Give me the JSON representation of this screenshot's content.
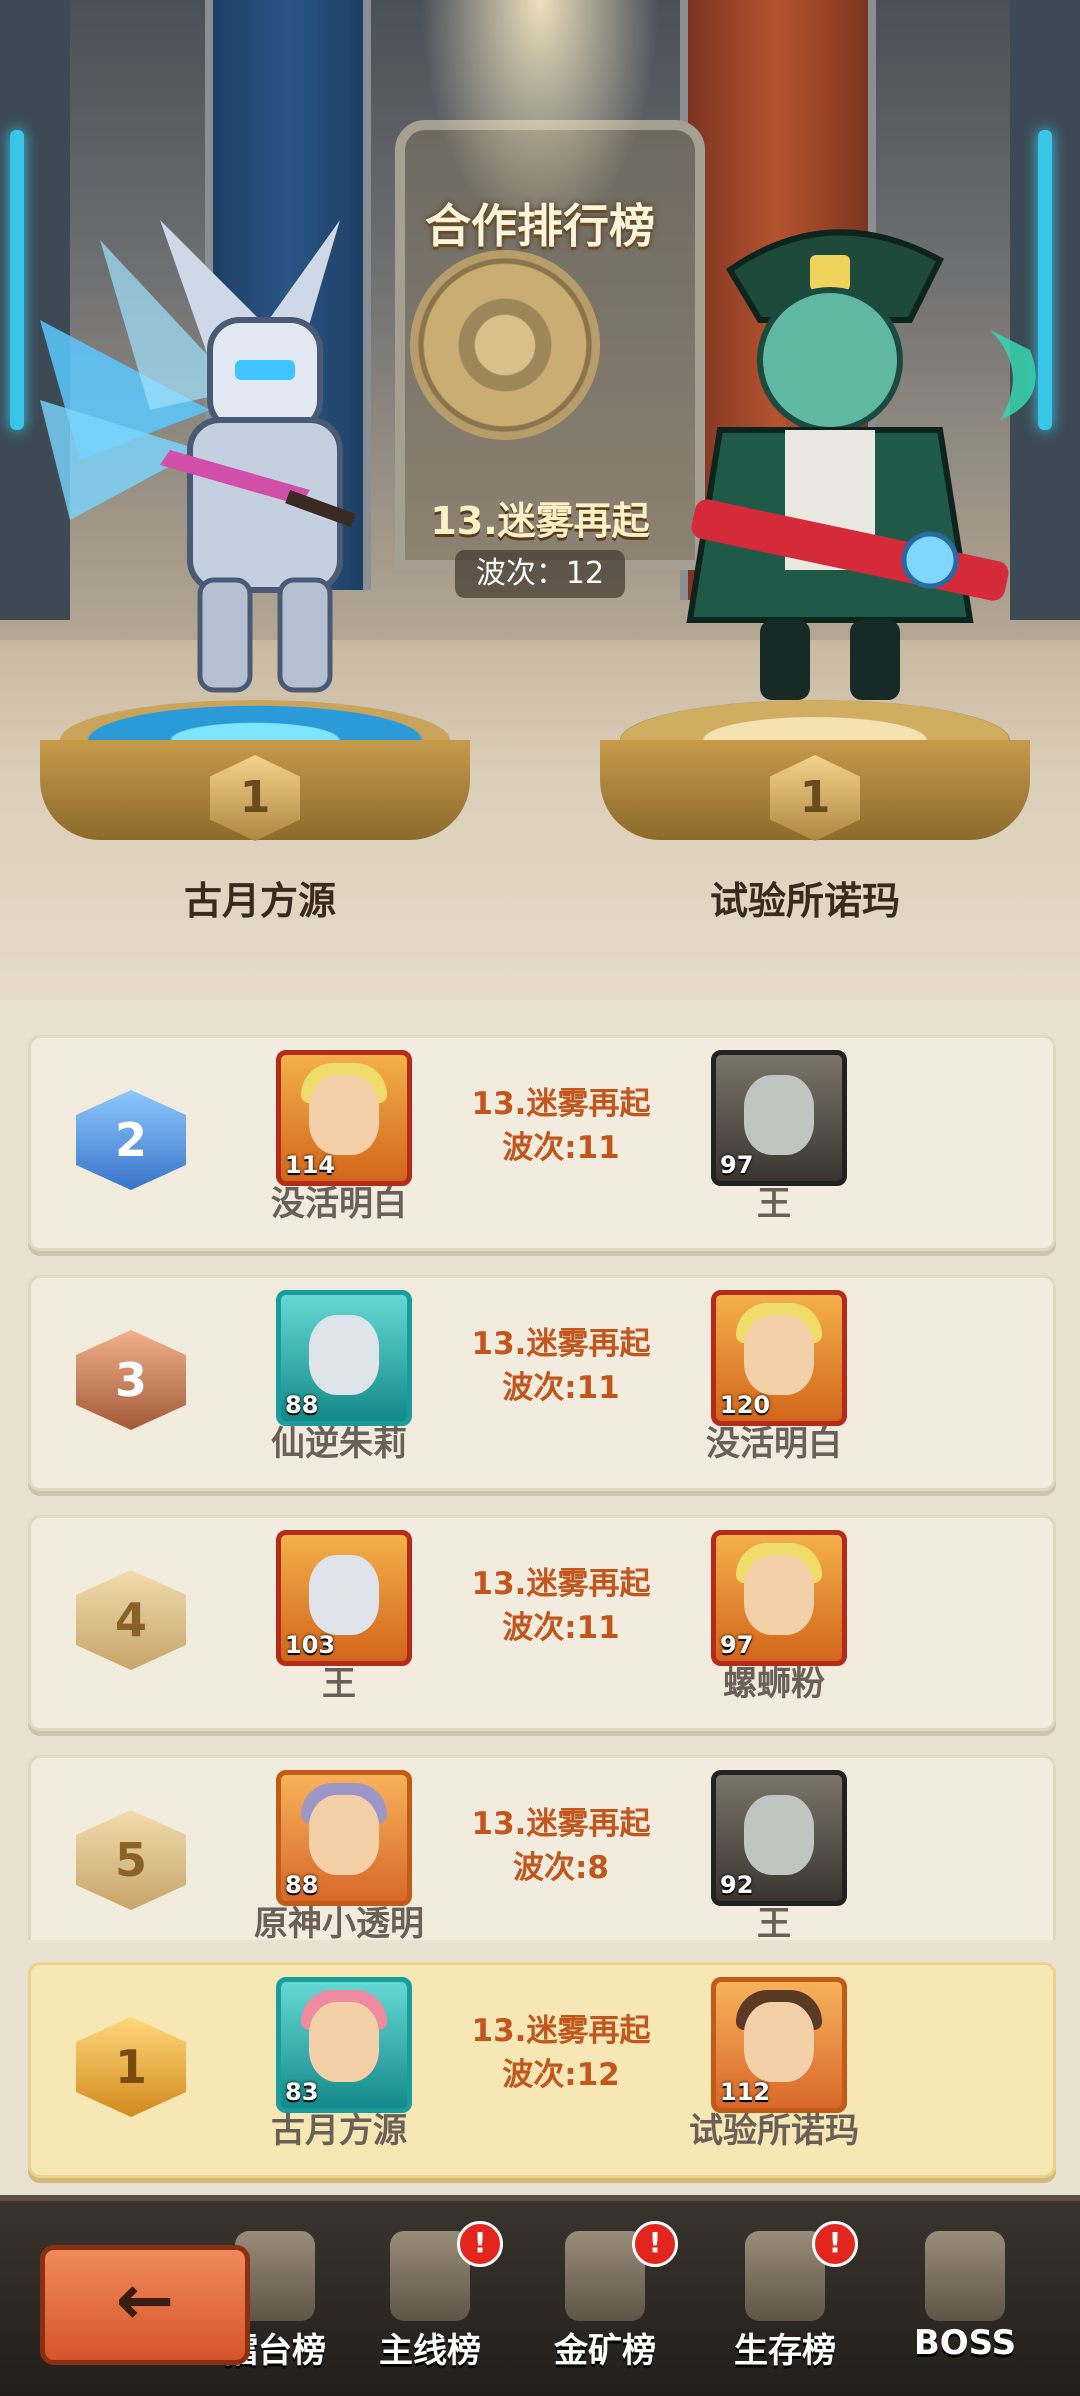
{
  "hero": {
    "title": "合作排行榜",
    "stage": "13.迷雾再起",
    "wave": "波次：12",
    "rank_badge": "1",
    "left_player": "古月方源",
    "right_player": "试验所诺玛"
  },
  "ranks": [
    {
      "rank": "2",
      "left": {
        "name": "没活明白",
        "level": "114"
      },
      "stage": "13.迷雾再起",
      "wave": "波次:11",
      "right": {
        "name": "王",
        "level": "97"
      }
    },
    {
      "rank": "3",
      "left": {
        "name": "仙逆朱莉",
        "level": "88"
      },
      "stage": "13.迷雾再起",
      "wave": "波次:11",
      "right": {
        "name": "没活明白",
        "level": "120"
      }
    },
    {
      "rank": "4",
      "left": {
        "name": "王",
        "level": "103"
      },
      "stage": "13.迷雾再起",
      "wave": "波次:11",
      "right": {
        "name": "螺蛳粉",
        "level": "97"
      }
    },
    {
      "rank": "5",
      "left": {
        "name": "原神小透明",
        "level": "88"
      },
      "stage": "13.迷雾再起",
      "wave": "波次:8",
      "right": {
        "name": "王",
        "level": "92"
      }
    }
  ],
  "mine": {
    "rank": "1",
    "left": {
      "name": "古月方源",
      "level": "83"
    },
    "stage": "13.迷雾再起",
    "wave": "波次:12",
    "right": {
      "name": "试验所诺玛",
      "level": "112"
    }
  },
  "tabs": [
    {
      "label": "擂台榜"
    },
    {
      "label": "主线榜",
      "alert": "!"
    },
    {
      "label": "金矿榜",
      "alert": "!"
    },
    {
      "label": "生存榜",
      "alert": "!"
    },
    {
      "label": "BOSS"
    }
  ],
  "back_icon": "arrow-left-icon",
  "colors": {
    "accent": "#c2561c",
    "alert": "#e2261d"
  }
}
